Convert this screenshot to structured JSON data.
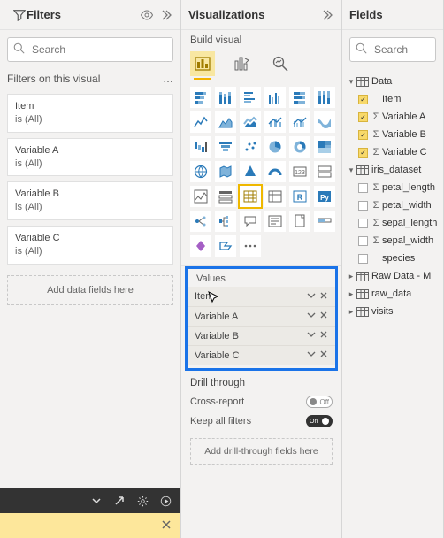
{
  "filters": {
    "title": "Filters",
    "search_placeholder": "Search",
    "subheader": "Filters on this visual",
    "ellipsis": "…",
    "cards": [
      {
        "field": "Item",
        "condition": "is (All)"
      },
      {
        "field": "Variable A",
        "condition": "is (All)"
      },
      {
        "field": "Variable B",
        "condition": "is (All)"
      },
      {
        "field": "Variable C",
        "condition": "is (All)"
      }
    ],
    "add_placeholder": "Add data fields here"
  },
  "viz": {
    "title": "Visualizations",
    "subtitle": "Build visual",
    "values_label": "Values",
    "value_fields": [
      "Item",
      "Variable A",
      "Variable B",
      "Variable C"
    ],
    "drill_header": "Drill through",
    "cross_report_label": "Cross-report",
    "cross_report_off": "Off",
    "keep_filters_label": "Keep all filters",
    "keep_filters_on": "On",
    "add_drill_label": "Add drill-through fields here"
  },
  "fields": {
    "title": "Fields",
    "search_placeholder": "Search",
    "tables": [
      {
        "name": "Data",
        "expanded": true,
        "columns": [
          {
            "name": "Item",
            "checked": true,
            "sigma": false
          },
          {
            "name": "Variable A",
            "checked": true,
            "sigma": true
          },
          {
            "name": "Variable B",
            "checked": true,
            "sigma": true
          },
          {
            "name": "Variable C",
            "checked": true,
            "sigma": true
          }
        ]
      },
      {
        "name": "iris_dataset",
        "expanded": true,
        "columns": [
          {
            "name": "petal_length",
            "checked": false,
            "sigma": true
          },
          {
            "name": "petal_width",
            "checked": false,
            "sigma": true
          },
          {
            "name": "sepal_length",
            "checked": false,
            "sigma": true
          },
          {
            "name": "sepal_width",
            "checked": false,
            "sigma": true
          },
          {
            "name": "species",
            "checked": false,
            "sigma": false
          }
        ]
      },
      {
        "name": "Raw Data - M",
        "expanded": false,
        "columns": []
      },
      {
        "name": "raw_data",
        "expanded": false,
        "columns": []
      },
      {
        "name": "visits",
        "expanded": false,
        "columns": []
      }
    ]
  }
}
